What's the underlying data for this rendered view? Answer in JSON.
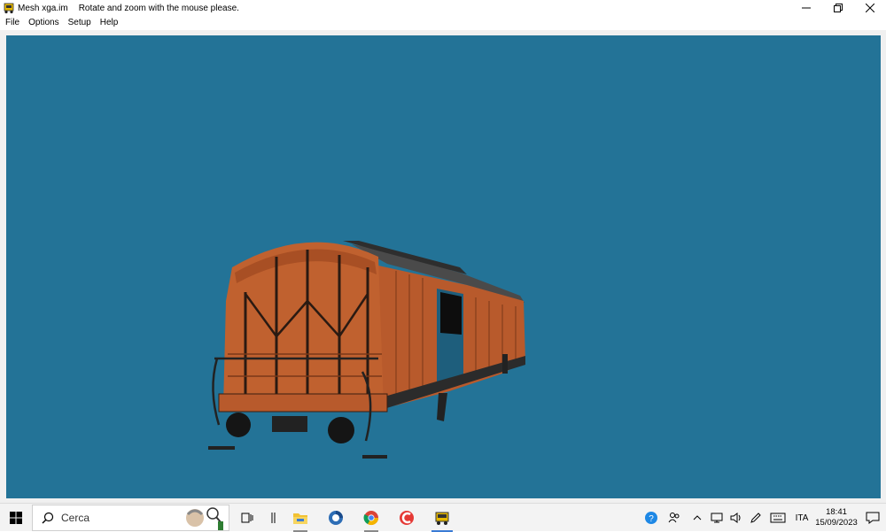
{
  "window": {
    "title": "Mesh xga.im",
    "hint": "Rotate and zoom with the mouse please.",
    "controls": [
      "minimize-icon",
      "restore-icon",
      "close-icon"
    ]
  },
  "menu": {
    "items": [
      {
        "label": "File"
      },
      {
        "label": "Options"
      },
      {
        "label": "Setup"
      },
      {
        "label": "Help"
      }
    ]
  },
  "viewport": {
    "background": "#237397",
    "model": "brown-freight-wagon-3d"
  },
  "taskbar": {
    "search_placeholder": "Cerca",
    "apps": [
      "task-view-icon",
      "file-explorer-icon",
      "app-round-icon",
      "chrome-icon",
      "ccleaner-icon",
      "mesh-app-icon"
    ],
    "language": "ITA",
    "time": "18:41",
    "date": "15/09/2023"
  }
}
